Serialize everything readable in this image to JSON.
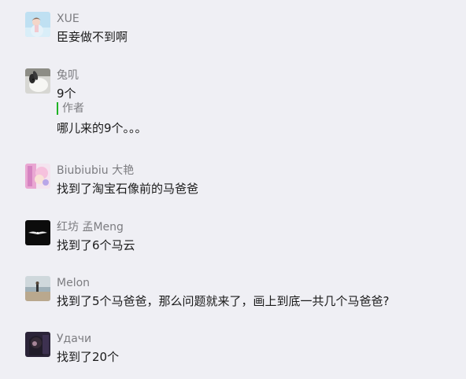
{
  "comments": [
    {
      "author": "XUE",
      "text": "臣妾做不到啊",
      "avatar_icon": "avatar-girl-icon"
    },
    {
      "author": "兔叽",
      "text": "9个",
      "reply_label": "作者",
      "reply_text": "哪儿来的9个。。。",
      "avatar_icon": "avatar-rabbit-icon"
    },
    {
      "author": "Biubiubiu 大艳",
      "text": "找到了淘宝石像前的马爸爸",
      "avatar_icon": "avatar-anime-icon"
    },
    {
      "author": "红坊 孟Meng",
      "text": "找到了6个马云",
      "avatar_icon": "avatar-bird-icon"
    },
    {
      "author": "Melon",
      "text": "找到了5个马爸爸，那么问题就来了，画上到底一共几个马爸爸?",
      "avatar_icon": "avatar-beach-icon"
    },
    {
      "author": "Удачи",
      "text": "找到了20个",
      "avatar_icon": "avatar-portrait-icon"
    }
  ],
  "colors": {
    "background": "#efeff4",
    "author_text": "#7c7c80",
    "body_text": "#1a1a1a",
    "reply_bar": "#1fb325"
  }
}
